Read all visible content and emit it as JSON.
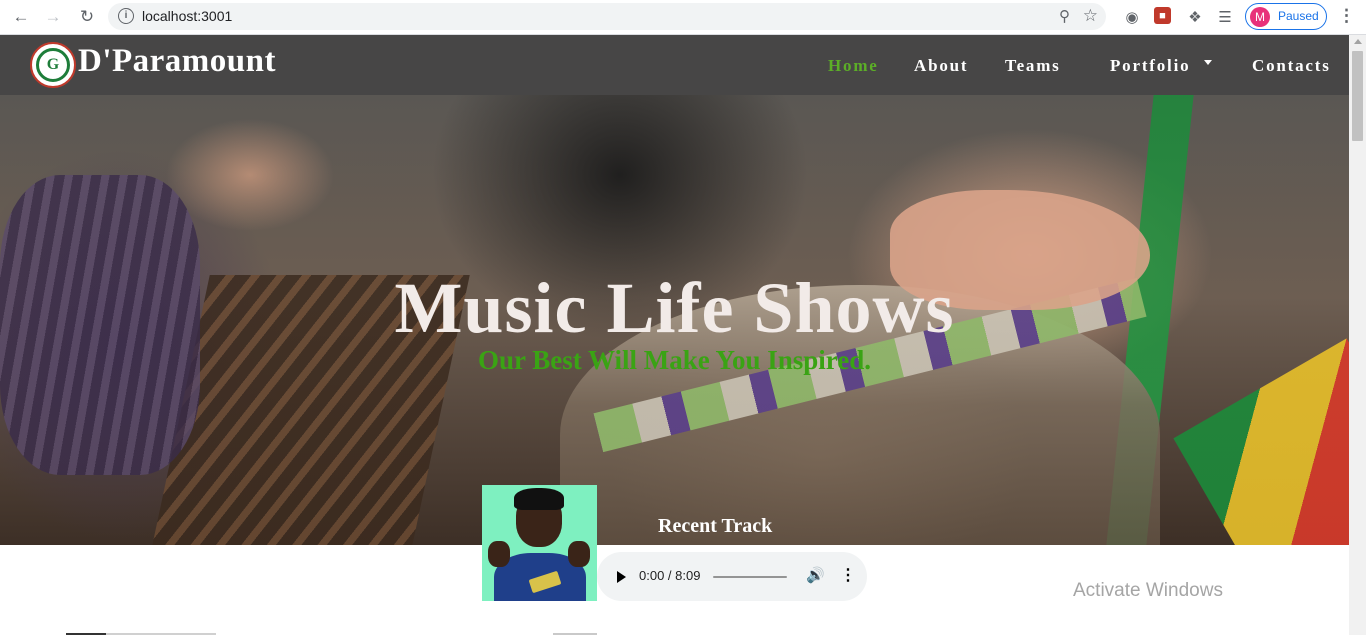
{
  "browser": {
    "url": "localhost:3001",
    "profile_initial": "M",
    "profile_status": "Paused"
  },
  "site": {
    "brand": "D'Paramount",
    "logo_letters": "G",
    "nav": {
      "home": "Home",
      "about": "About",
      "teams": "Teams",
      "portfolio": "Portfolio",
      "contacts": "Contacts"
    },
    "accent_color": "#5cae27",
    "nav_bg_color": "#474646"
  },
  "hero": {
    "title": "Music Life Shows",
    "subtitle": "Our Best Will Make You Inspired."
  },
  "track": {
    "heading": "Recent Track",
    "time": "0:00 / 8:09",
    "progress": 0
  },
  "os_overlay": {
    "watermark": "Activate Windows"
  },
  "icons": [
    "back-icon",
    "forward-icon",
    "reload-icon",
    "info-icon",
    "zoom-icon",
    "star-icon",
    "extension-icon",
    "puzzle-icon",
    "playlist-icon",
    "more-icon",
    "play-icon",
    "volume-icon",
    "caret-down-icon"
  ]
}
